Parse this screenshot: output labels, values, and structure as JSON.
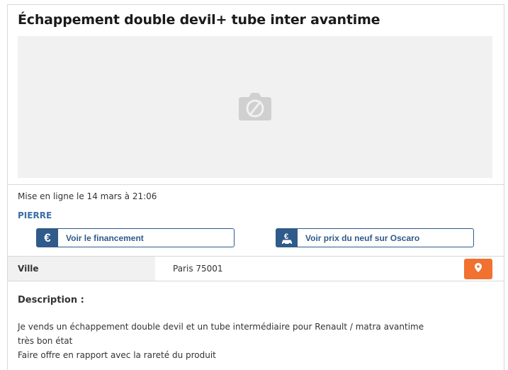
{
  "listing": {
    "title": "Échappement double devil+ tube inter avantime",
    "photo_icon": "camera-unavailable-icon",
    "posted": "Mise en ligne le 14 mars à 21:06",
    "seller": "PIERRE"
  },
  "actions": {
    "financing": {
      "icon": "euro-icon",
      "icon_text": "€",
      "label": "Voir le financement"
    },
    "oscaro": {
      "icon": "euro-car-icon",
      "label": "Voir prix du neuf sur Oscaro"
    }
  },
  "location": {
    "label": "Ville",
    "value": "Paris 75001",
    "map_icon": "location-pin-icon"
  },
  "description": {
    "title": "Description :",
    "lines": [
      "Je vends un échappement double devil et un tube intermédiaire pour Renault / matra avantime",
      "très bon état",
      "Faire offre en rapport avec la rareté du produit"
    ]
  },
  "colors": {
    "accent_blue": "#2f5b8a",
    "seller_blue": "#3a6ea5",
    "map_orange": "#f07130",
    "photo_bg": "#f1f1f1"
  }
}
